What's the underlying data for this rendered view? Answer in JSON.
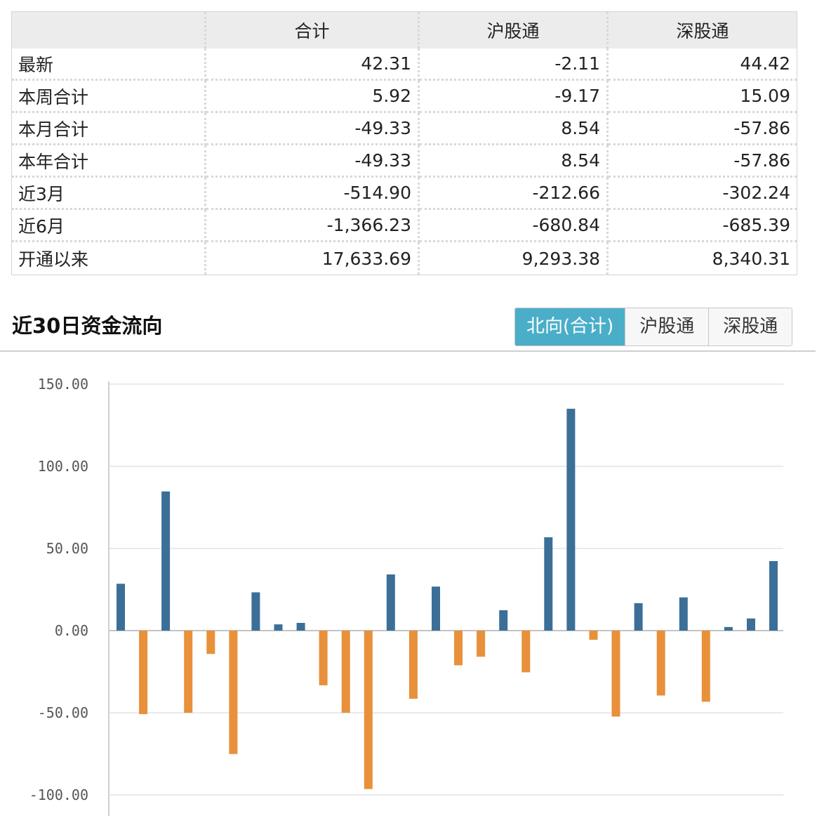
{
  "table": {
    "headers": [
      "",
      "合计",
      "沪股通",
      "深股通"
    ],
    "rows": [
      {
        "label": "最新",
        "total": "42.31",
        "sh": "-2.11",
        "sz": "44.42"
      },
      {
        "label": "本周合计",
        "total": "5.92",
        "sh": "-9.17",
        "sz": "15.09"
      },
      {
        "label": "本月合计",
        "total": "-49.33",
        "sh": "8.54",
        "sz": "-57.86"
      },
      {
        "label": "本年合计",
        "total": "-49.33",
        "sh": "8.54",
        "sz": "-57.86"
      },
      {
        "label": "近3月",
        "total": "-514.90",
        "sh": "-212.66",
        "sz": "-302.24"
      },
      {
        "label": "近6月",
        "total": "-1,366.23",
        "sh": "-680.84",
        "sz": "-685.39"
      },
      {
        "label": "开通以来",
        "total": "17,633.69",
        "sh": "9,293.38",
        "sz": "8,340.31"
      }
    ]
  },
  "section": {
    "title": "近30日资金流向",
    "tabs": [
      "北向(合计)",
      "沪股通",
      "深股通"
    ],
    "active_tab": 0
  },
  "colors": {
    "positive": "#3b6f98",
    "negative": "#e8903a",
    "tab_active": "#4aaec8"
  },
  "chart_data": {
    "type": "bar",
    "title": "",
    "xlabel": "",
    "ylabel": "",
    "ylim": [
      -100,
      150
    ],
    "yticks": [
      "150.00",
      "100.00",
      "50.00",
      "0.00",
      "-50.00",
      "-100.00"
    ],
    "ytick_values": [
      150,
      100,
      50,
      0,
      -50,
      -100
    ],
    "grid": true,
    "values": [
      28.5,
      -50.8,
      84.7,
      -50.0,
      -14.2,
      -75.1,
      23.3,
      3.8,
      4.7,
      -33.3,
      -50.0,
      -96.4,
      34.2,
      -41.5,
      26.8,
      -21.1,
      -15.9,
      12.4,
      -25.4,
      56.8,
      135.0,
      -5.6,
      -52.3,
      16.7,
      -39.5,
      20.2,
      -43.3,
      2.2,
      7.4,
      42.3
    ]
  }
}
